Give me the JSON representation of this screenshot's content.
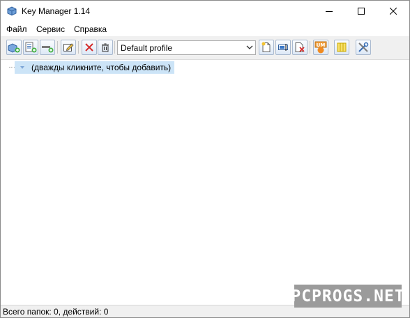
{
  "window": {
    "title": "Key Manager 1.14",
    "icon": "key-manager-app-icon"
  },
  "menu": {
    "items": [
      "Файл",
      "Сервис",
      "Справка"
    ]
  },
  "toolbar": {
    "profile_value": "Default profile",
    "icons": [
      "add-folder-icon",
      "add-action-icon",
      "add-separator-icon",
      "edit-icon",
      "delete-icon",
      "trash-icon",
      "new-profile-icon",
      "rename-profile-icon",
      "delete-profile-icon",
      "um-icon",
      "columns-icon",
      "settings-tools-icon"
    ]
  },
  "tree": {
    "items": [
      {
        "label": "(дважды кликните, чтобы добавить)",
        "selected": true
      }
    ]
  },
  "status": {
    "text": "Всего папок: 0, действий: 0"
  },
  "watermark": {
    "text": "PCPROGS.NET"
  },
  "colors": {
    "selection": "#cce4f7",
    "toolbar_bg": "#f0f0f0",
    "watermark_bg": "#9b9b9b"
  }
}
